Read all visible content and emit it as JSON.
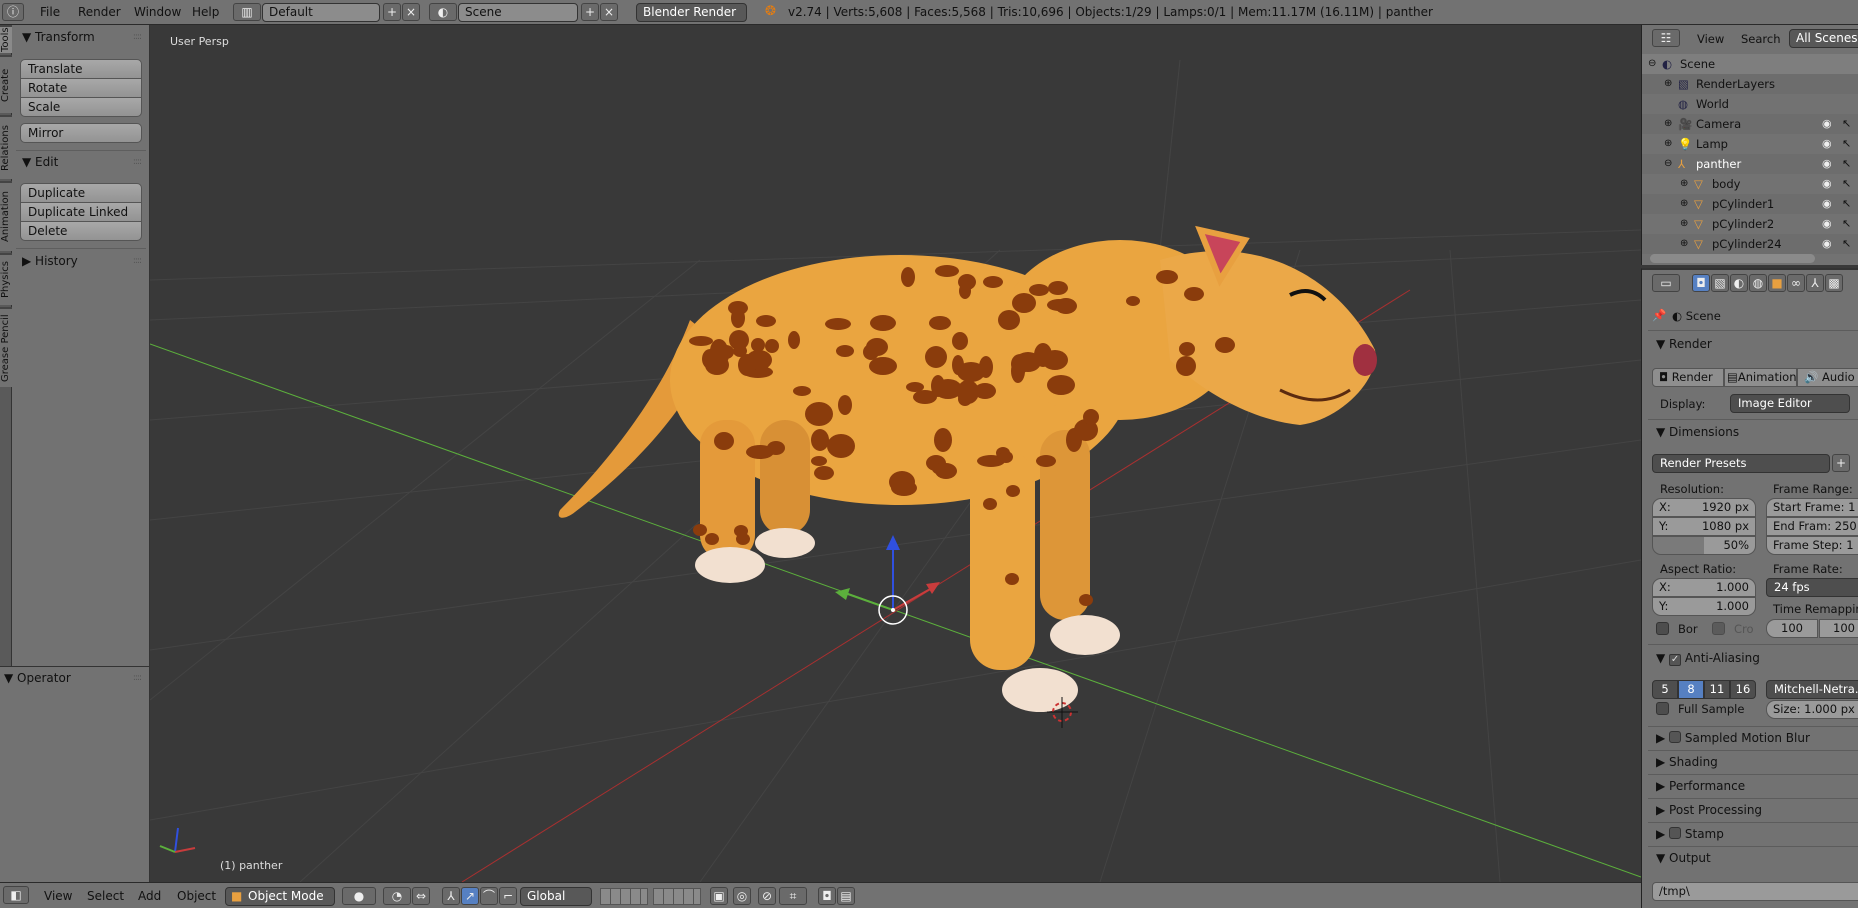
{
  "topbar": {
    "menus": [
      "File",
      "Render",
      "Window",
      "Help"
    ],
    "layout": "Default",
    "scene": "Scene",
    "engine": "Blender Render",
    "stats": "v2.74 | Verts:5,608 | Faces:5,568 | Tris:10,696 | Objects:1/29 | Lamps:0/1 | Mem:11.17M (16.11M) | panther"
  },
  "tabs": [
    "Tools",
    "Create",
    "Relations",
    "Animation",
    "Physics",
    "Grease Pencil"
  ],
  "shelf": {
    "transform": {
      "title": "Transform",
      "buttons": [
        "Translate",
        "Rotate",
        "Scale"
      ],
      "mirror": "Mirror"
    },
    "edit": {
      "title": "Edit",
      "buttons": [
        "Duplicate",
        "Duplicate Linked",
        "Delete"
      ]
    },
    "history": "History",
    "operator": "Operator"
  },
  "viewport": {
    "label": "User Persp",
    "object_label": "(1) panther"
  },
  "bottombar": {
    "menus": [
      "View",
      "Select",
      "Add",
      "Object"
    ],
    "mode": "Object Mode",
    "orientation": "Global"
  },
  "outliner": {
    "menus": [
      "View",
      "Search"
    ],
    "filter": "All Scenes",
    "rows": [
      "Scene",
      "RenderLayers",
      "World",
      "Camera",
      "Lamp",
      "panther",
      "body",
      "pCylinder1",
      "pCylinder2",
      "pCylinder24"
    ]
  },
  "props": {
    "context": "Scene",
    "render": {
      "title": "Render",
      "buttons": [
        "Render",
        "Animation",
        "Audio"
      ],
      "display_label": "Display:",
      "display": "Image Editor"
    },
    "dimensions": {
      "title": "Dimensions",
      "presets": "Render Presets",
      "resolution_label": "Resolution:",
      "res_x": "X:",
      "res_x_val": "1920 px",
      "res_y": "Y:",
      "res_y_val": "1080 px",
      "percent": "50%",
      "frame_range_label": "Frame Range:",
      "start": "Start Frame: 1",
      "end": "End Fram: 250",
      "step": "Frame Step: 1",
      "aspect_label": "Aspect Ratio:",
      "asp_x": "X:",
      "asp_x_val": "1.000",
      "asp_y": "Y:",
      "asp_y_val": "1.000",
      "frame_rate_label": "Frame Rate:",
      "frame_rate": "24 fps",
      "bor": "Bor",
      "cro": "Cro",
      "time_remap_label": "Time Remapping",
      "remap_old": "100",
      "remap_new": "100"
    },
    "aa": {
      "title": "Anti-Aliasing",
      "samples": [
        "5",
        "8",
        "11",
        "16"
      ],
      "selected": "8",
      "filter": "Mitchell-Netra...",
      "full_sample": "Full Sample",
      "size": "Size: 1.000 px"
    },
    "collapsed": [
      "Sampled Motion Blur",
      "Shading",
      "Performance",
      "Post Processing",
      "Stamp"
    ],
    "output": {
      "title": "Output",
      "path": "/tmp\\"
    }
  },
  "colors": {
    "selected_sample": "#5680c2",
    "panther": "#e8a040",
    "spots": "#8a3c0c",
    "x_axis": "#c83c3c",
    "y_axis": "#5cb03c",
    "z_axis": "#3050e0"
  }
}
